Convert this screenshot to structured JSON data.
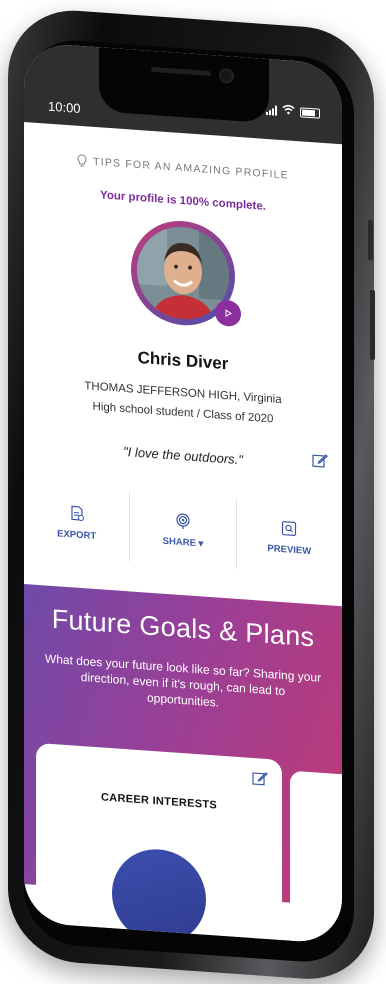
{
  "status_bar": {
    "time": "10:00"
  },
  "profile": {
    "tips_label": "TIPS FOR AN AMAZING PROFILE",
    "completion_text": "Your profile is 100% complete.",
    "name": "Chris Diver",
    "school": "THOMAS JEFFERSON HIGH, Virginia",
    "grade": "High school student / Class of 2020",
    "quote": "\"I love the outdoors.\""
  },
  "actions": {
    "export_label": "EXPORT",
    "share_label": "SHARE ▾",
    "preview_label": "PREVIEW"
  },
  "goals": {
    "title": "Future Goals & Plans",
    "description": "What does your future look like so far? Sharing your direction, even if it's rough, can lead to opportunities.",
    "card_title": "CAREER INTERESTS"
  },
  "colors": {
    "accent_purple": "#7a2e9a",
    "link_blue": "#3a56a8",
    "gradient_start": "#6f4aa8",
    "gradient_end": "#c23a74"
  },
  "icons": [
    "lightbulb-icon",
    "play-icon",
    "edit-icon",
    "export-icon",
    "share-icon",
    "preview-icon",
    "signal-icon",
    "wifi-icon",
    "battery-icon"
  ]
}
